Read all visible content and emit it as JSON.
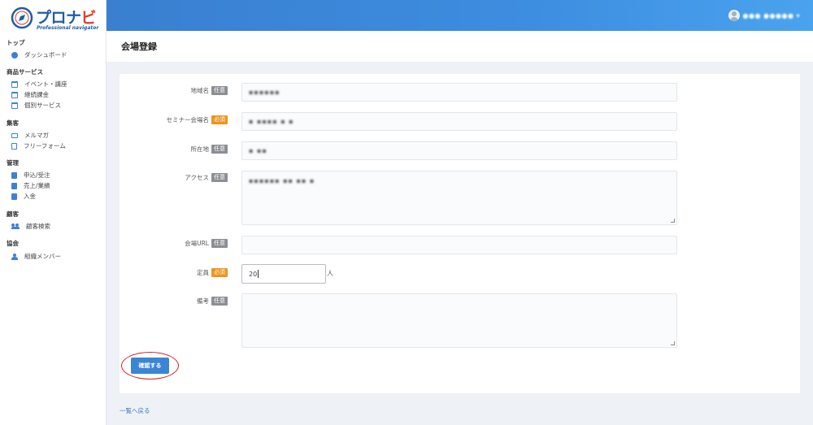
{
  "brand": {
    "name_blue": "プロナ",
    "name_red": "ビ",
    "tagline": "Professional navigator"
  },
  "sidebar": {
    "groups": [
      {
        "label": "トップ",
        "items": [
          {
            "label": "ダッシュボード",
            "icon": "dashboard-icon"
          }
        ]
      },
      {
        "label": "商品サービス",
        "items": [
          {
            "label": "イベント・講座",
            "icon": "calendar-icon"
          },
          {
            "label": "継続課金",
            "icon": "calendar-icon"
          },
          {
            "label": "個別サービス",
            "icon": "calendar-icon"
          }
        ]
      },
      {
        "label": "集客",
        "items": [
          {
            "label": "メルマガ",
            "icon": "mail-icon"
          },
          {
            "label": "フリーフォーム",
            "icon": "document-icon"
          }
        ]
      },
      {
        "label": "管理",
        "items": [
          {
            "label": "申込/受注",
            "icon": "folder-icon"
          },
          {
            "label": "売上/業績",
            "icon": "folder-icon"
          },
          {
            "label": "入金",
            "icon": "folder-icon"
          }
        ]
      },
      {
        "label": "顧客",
        "items": [
          {
            "label": "顧客検索",
            "icon": "users-icon"
          }
        ]
      },
      {
        "label": "協会",
        "items": [
          {
            "label": "組織メンバー",
            "icon": "person-icon"
          }
        ]
      }
    ]
  },
  "header": {
    "user_name": "●●● ●●●●● ▾",
    "caret": "▾"
  },
  "page": {
    "title": "会場登録"
  },
  "form": {
    "fields": [
      {
        "label": "地域名",
        "tag": "任意",
        "required": false,
        "value": "▪▪▪▪▪▪",
        "type": "input"
      },
      {
        "label": "セミナー会場名",
        "tag": "必須",
        "required": true,
        "value": "▪ ▪▪▪▪  ▪ ▪",
        "type": "input"
      },
      {
        "label": "所在地",
        "tag": "任意",
        "required": false,
        "value": "▪ ▪▪",
        "type": "input"
      },
      {
        "label": "アクセス",
        "tag": "任意",
        "required": false,
        "value": "▪▪▪▪▪▪  ▪▪  ▪▪  ▪",
        "type": "textarea"
      },
      {
        "label": "会場URL",
        "tag": "任意",
        "required": false,
        "value": "",
        "type": "input"
      },
      {
        "label": "定員",
        "tag": "必須",
        "required": true,
        "value": "20",
        "unit": "人",
        "type": "number"
      },
      {
        "label": "備考",
        "tag": "任意",
        "required": false,
        "value": "",
        "type": "textarea"
      }
    ],
    "submit_label": "確認する"
  },
  "footer": {
    "back_link": "一覧へ戻る"
  },
  "colors": {
    "accent": "#3a86d4",
    "required_tag": "#f0931c",
    "optional_tag": "#8a8f95",
    "highlight_circle": "#d31f1f"
  }
}
